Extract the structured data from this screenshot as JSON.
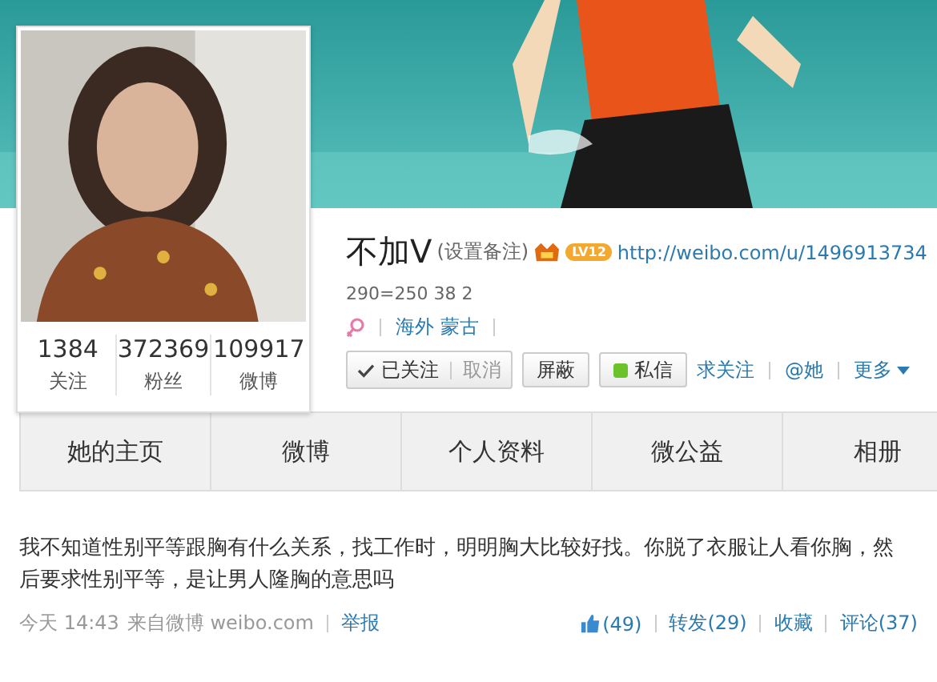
{
  "profile": {
    "name": "不加V",
    "remark_link": "(设置备注)",
    "level_badge": "LV12",
    "url": "http://weibo.com/u/1496913734",
    "bio": "290=250 38 2",
    "location": "海外 蒙古"
  },
  "stats": [
    {
      "value": "1384",
      "label": "关注"
    },
    {
      "value": "372369",
      "label": "粉丝"
    },
    {
      "value": "109917",
      "label": "微博"
    }
  ],
  "actions": {
    "followed": "已关注",
    "unfollow": "取消",
    "block": "屏蔽",
    "message": "私信",
    "ask_follow": "求关注",
    "mention": "@她",
    "more": "更多"
  },
  "tabs": [
    {
      "label": "她的主页",
      "selected": false
    },
    {
      "label": "微博",
      "selected": false
    },
    {
      "label": "个人资料",
      "selected": false
    },
    {
      "label": "微公益",
      "selected": false
    },
    {
      "label": "相册",
      "selected": false
    }
  ],
  "post": {
    "text": "我不知道性别平等跟胸有什么关系，找工作时，明明胸大比较好找。你脱了衣服让人看你胸，然后要求性别平等，是让男人隆胸的意思吗",
    "time": "今天 14:43",
    "source": "来自微博 weibo.com",
    "report": "举报",
    "likes": "(49)",
    "repost": "转发(29)",
    "favorite": "收藏",
    "comment": "评论(37)"
  }
}
